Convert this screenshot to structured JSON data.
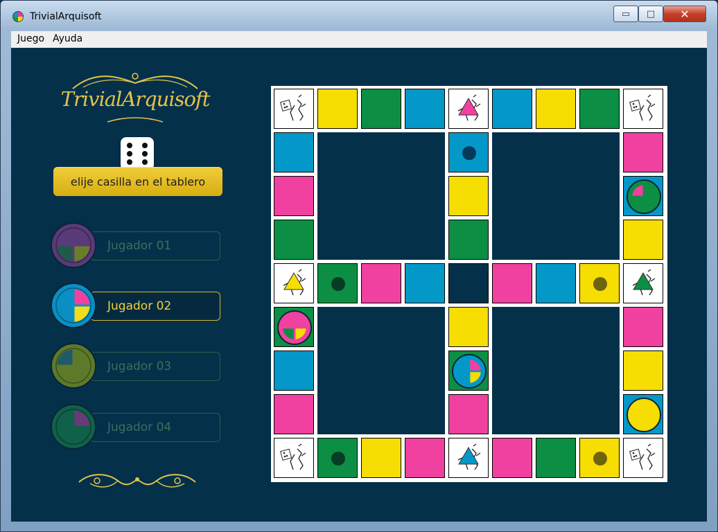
{
  "window": {
    "title": "TrivialArquisoft",
    "min_symbol": "▭",
    "max_symbol": "□",
    "close_symbol": "✕"
  },
  "menu": {
    "items": [
      "Juego",
      "Ayuda"
    ]
  },
  "logo": {
    "text": "TrivialArquisoft"
  },
  "dice": {
    "value": 6
  },
  "status": {
    "text": "elije casilla en el tablero"
  },
  "players": [
    {
      "name": "Jugador 01",
      "active": false,
      "ring": "#5a3a78",
      "wedges": [
        "#5a3a78",
        "#5a3a78",
        "#6a7d2a",
        "#1f5a4a"
      ]
    },
    {
      "name": "Jugador 02",
      "active": true,
      "ring": "#0a8fc4",
      "wedges": [
        "#0a8fc4",
        "#f040a0",
        "#f2dd1c",
        "#0a8fc4"
      ]
    },
    {
      "name": "Jugador 03",
      "active": false,
      "ring": "#5d7a2a",
      "wedges": [
        "#1f5a6a",
        "#5d7a2a",
        "#5d7a2a",
        "#5d7a2a"
      ]
    },
    {
      "name": "Jugador 04",
      "active": false,
      "ring": "#11614a",
      "wedges": [
        "#11614a",
        "#6a3a78",
        "#11614a",
        "#11614a"
      ]
    }
  ],
  "colors": {
    "yellow": "#f6dd02",
    "green": "#0c8f44",
    "blue": "#0498c8",
    "pink": "#f040a0",
    "background": "#04304a",
    "gold": "#e2c44a"
  },
  "board": {
    "cells": [
      [
        "corner-dice",
        "yellow",
        "green",
        "blue",
        "wedge-pink",
        "blue",
        "yellow",
        "green",
        "corner-dice"
      ],
      [
        "blue",
        "",
        "",
        "",
        "blue-dot",
        "",
        "",
        "",
        "pink"
      ],
      [
        "pink",
        "",
        "",
        "",
        "yellow",
        "",
        "",
        "",
        "token-green"
      ],
      [
        "green",
        "",
        "",
        "",
        "green",
        "",
        "",
        "",
        "yellow"
      ],
      [
        "wedge-yellow",
        "green-dot",
        "pink",
        "blue",
        "dark",
        "pink",
        "blue",
        "yellow-dot",
        "wedge-green"
      ],
      [
        "token-pink",
        "",
        "",
        "",
        "yellow",
        "",
        "",
        "",
        "pink"
      ],
      [
        "blue",
        "",
        "",
        "",
        "token-blue",
        "",
        "",
        "",
        "yellow"
      ],
      [
        "pink",
        "",
        "",
        "",
        "pink",
        "",
        "",
        "",
        "token-yellow"
      ],
      [
        "corner-dice",
        "green-dot",
        "yellow",
        "pink",
        "wedge-blue",
        "pink",
        "green",
        "yellow-dot",
        "corner-dice"
      ]
    ]
  }
}
